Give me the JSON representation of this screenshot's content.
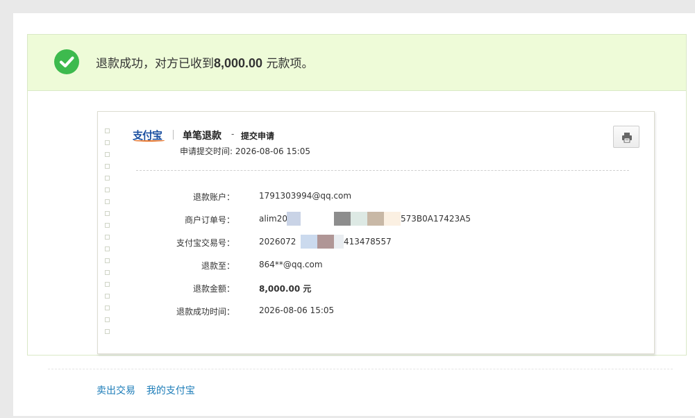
{
  "banner": {
    "text_prefix": "退款成功，对方已收到",
    "amount": "8,000.00",
    "text_suffix": " 元款项。"
  },
  "receipt": {
    "logo": "支付宝",
    "title": "单笔退款",
    "dash": "-",
    "subtitle": "提交申请",
    "submit_time_label": "申请提交时间:",
    "submit_time": "2026-08-06 15:05",
    "rows": [
      {
        "label": "退款账户：",
        "value": "1791303994@qq.com",
        "bold": false
      },
      {
        "label": "商户订单号：",
        "value": "alim202",
        "value_tail": "573B0A17423A5",
        "bold": false
      },
      {
        "label": "支付宝交易号：",
        "value": "2026072",
        "value_tail": "413478557",
        "bold": false
      },
      {
        "label": "退款至：",
        "value": "864**@qq.com",
        "bold": false
      },
      {
        "label": "退款金额：",
        "value": "8,000.00 元",
        "bold": true
      },
      {
        "label": "退款成功时间：",
        "value": "2026-08-06 15:05",
        "bold": false
      }
    ]
  },
  "footer": {
    "links": [
      "卖出交易",
      "我的支付宝"
    ]
  },
  "colors": {
    "banner_bg": "#eefbd8",
    "check": "#3dba4e",
    "link": "#1c7cb8",
    "logo": "#1a4fa0"
  }
}
